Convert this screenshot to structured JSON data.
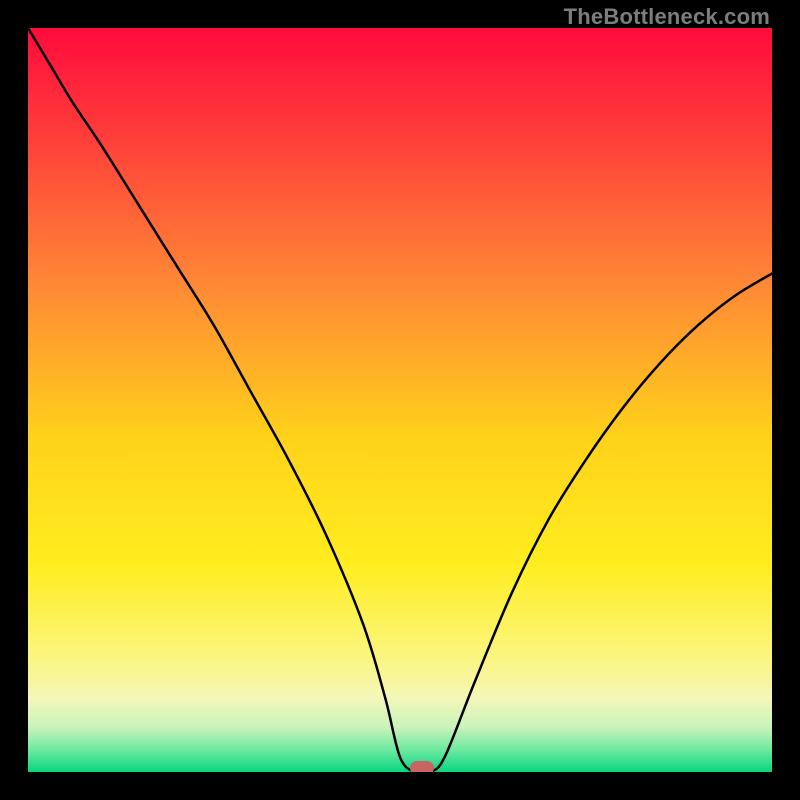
{
  "watermark": "TheBottleneck.com",
  "chart_data": {
    "type": "line",
    "title": "",
    "xlabel": "",
    "ylabel": "",
    "xlim": [
      0,
      100
    ],
    "ylim": [
      0,
      100
    ],
    "grid": false,
    "legend": false,
    "series": [
      {
        "name": "bottleneck-curve",
        "x": [
          0,
          3,
          6,
          10,
          15,
          20,
          25,
          30,
          35,
          40,
          45,
          48,
          50,
          52,
          54,
          56,
          60,
          65,
          70,
          75,
          80,
          85,
          90,
          95,
          100
        ],
        "y": [
          100,
          95,
          90,
          84,
          76,
          68,
          60,
          51,
          42,
          32,
          20,
          10,
          2,
          0,
          0,
          2,
          12,
          24,
          34,
          42,
          49,
          55,
          60,
          64,
          67
        ]
      }
    ],
    "marker": {
      "x": 53,
      "y": 0
    },
    "background_gradient": {
      "stops": [
        {
          "pos": 0.0,
          "color": "#ff0b3c"
        },
        {
          "pos": 0.15,
          "color": "#ff3f3a"
        },
        {
          "pos": 0.35,
          "color": "#ff8a35"
        },
        {
          "pos": 0.55,
          "color": "#ffd21a"
        },
        {
          "pos": 0.72,
          "color": "#ffed1f"
        },
        {
          "pos": 0.84,
          "color": "#fbf57a"
        },
        {
          "pos": 0.9,
          "color": "#f4f7b8"
        },
        {
          "pos": 0.94,
          "color": "#c9f3bb"
        },
        {
          "pos": 0.97,
          "color": "#6de9a0"
        },
        {
          "pos": 1.0,
          "color": "#08d67e"
        }
      ]
    }
  }
}
